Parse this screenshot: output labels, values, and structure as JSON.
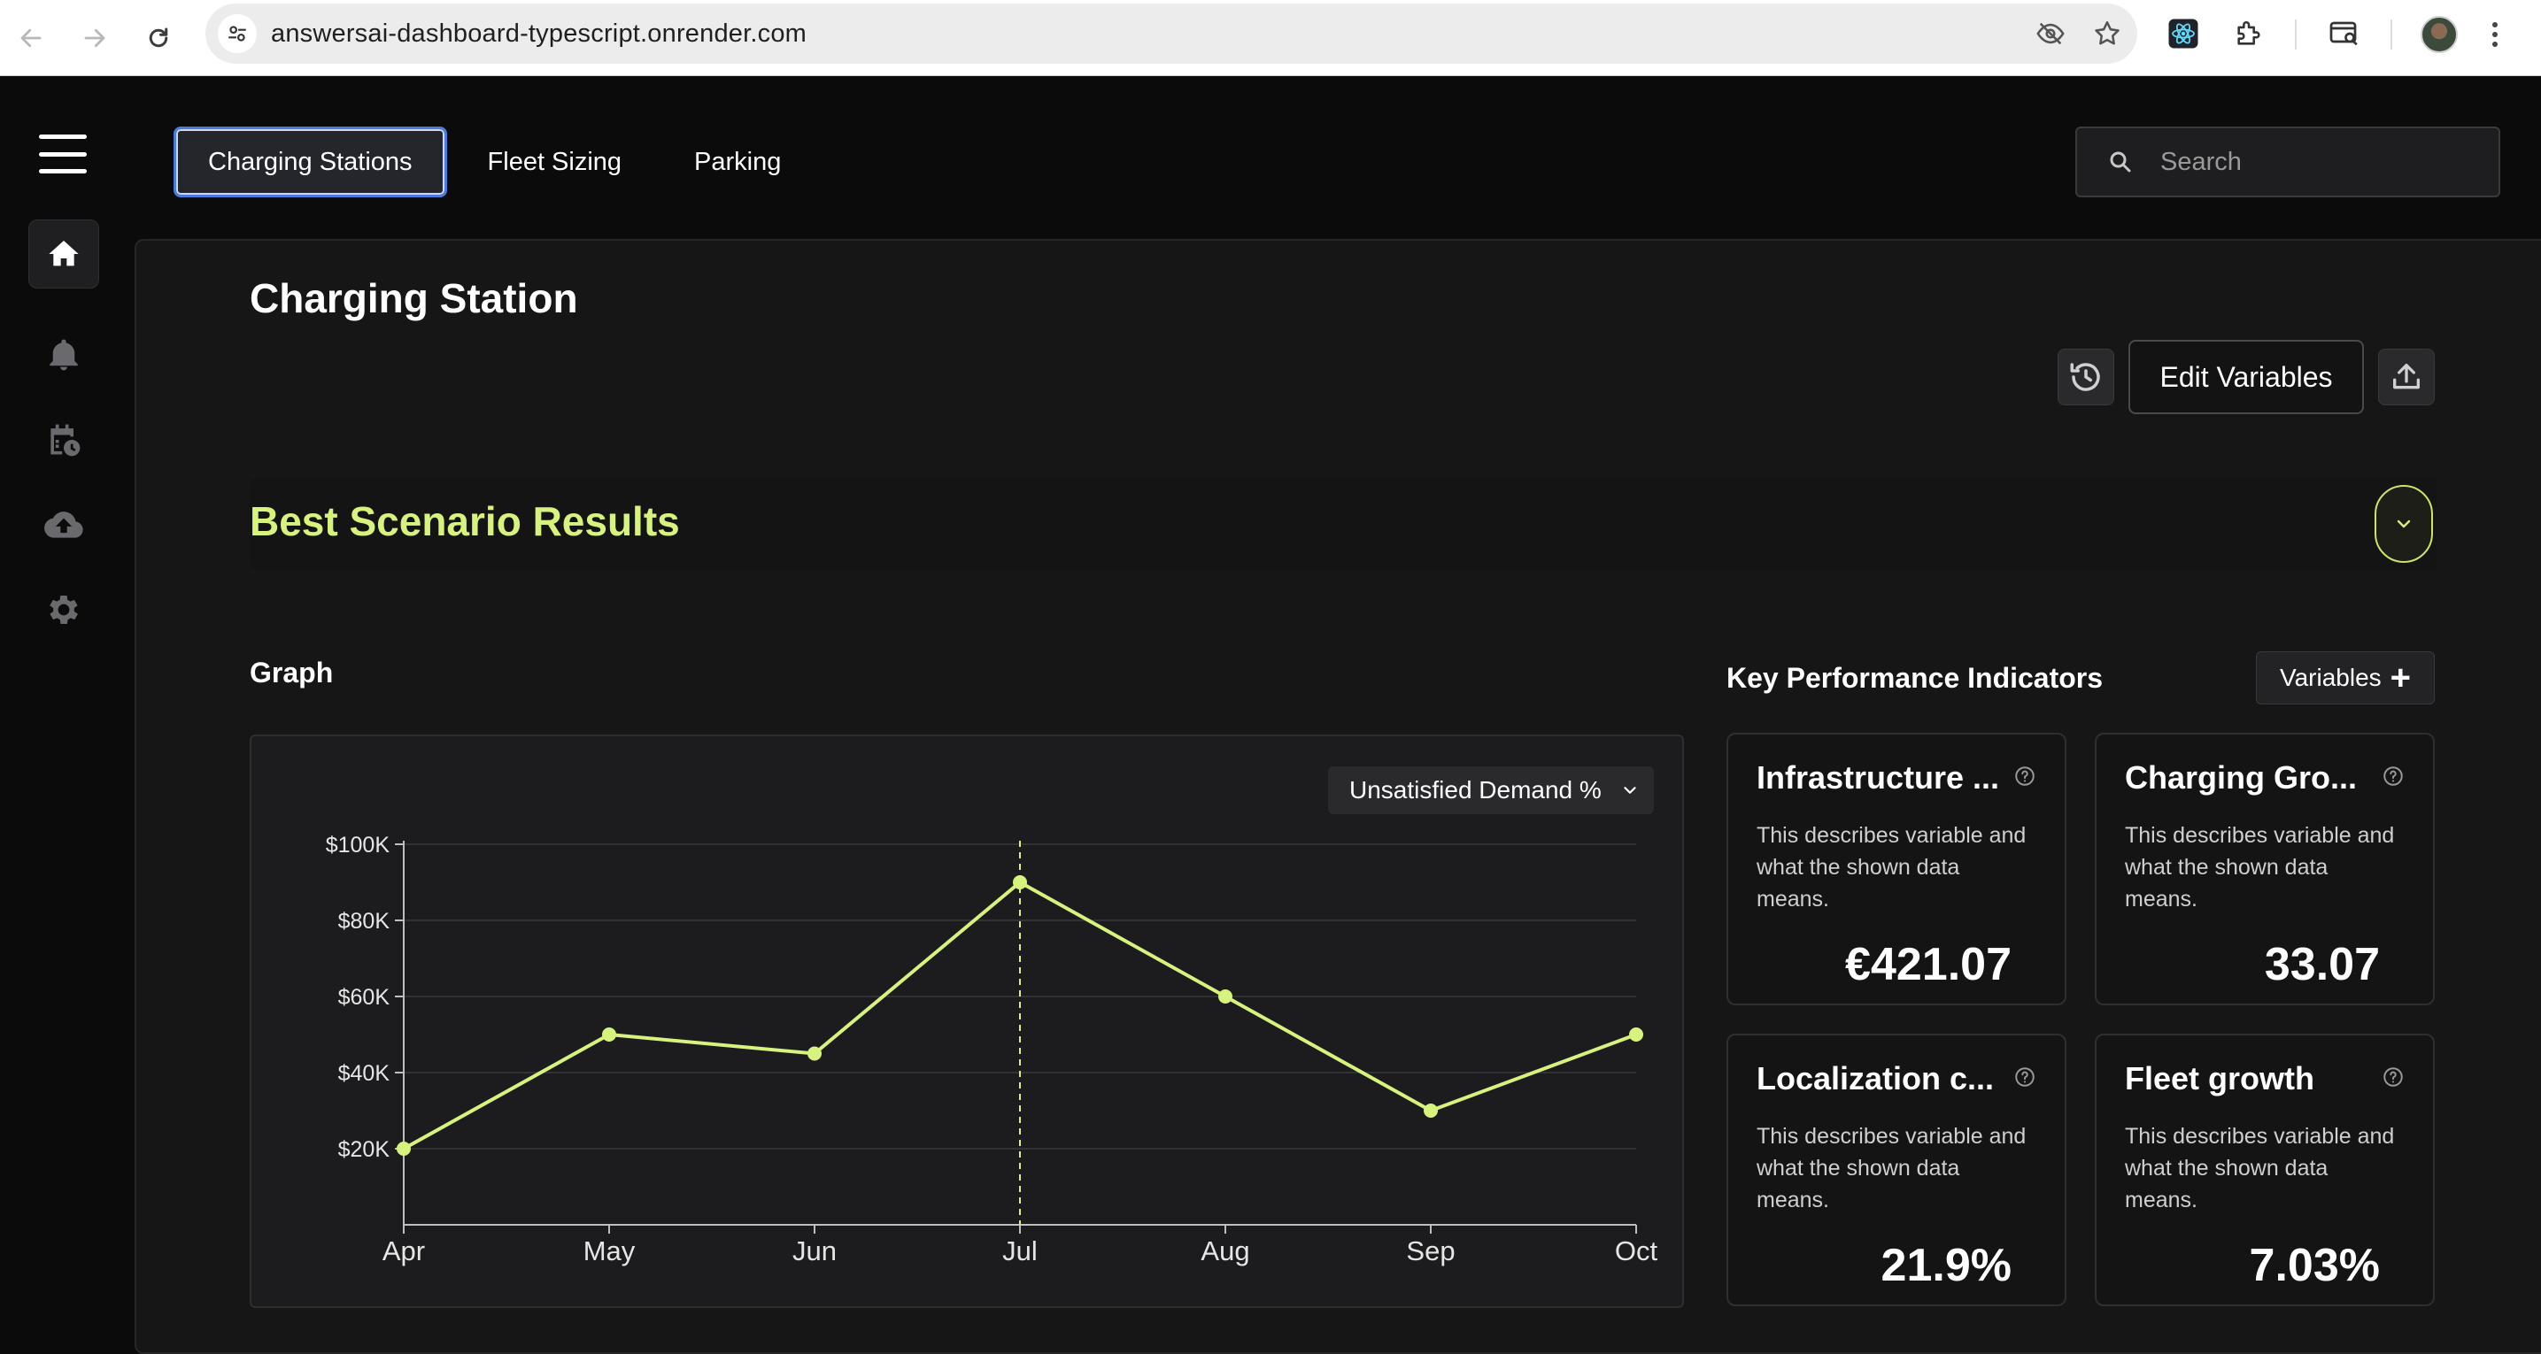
{
  "browser": {
    "url": "answersai-dashboard-typescript.onrender.com"
  },
  "nav": {
    "tabs": [
      {
        "label": "Charging Stations",
        "active": true
      },
      {
        "label": "Fleet Sizing",
        "active": false
      },
      {
        "label": "Parking",
        "active": false
      }
    ],
    "search_placeholder": "Search"
  },
  "sidebar": {
    "items": [
      {
        "icon": "home-icon",
        "active": true
      },
      {
        "icon": "bell-icon",
        "active": false
      },
      {
        "icon": "calendar-clock-icon",
        "active": false
      },
      {
        "icon": "cloud-upload-icon",
        "active": false
      },
      {
        "icon": "gear-icon",
        "active": false
      }
    ]
  },
  "page": {
    "title": "Charging Station",
    "edit_variables_label": "Edit Variables",
    "scenario_title": "Best Scenario Results"
  },
  "graph": {
    "label": "Graph",
    "metric_selected": "Unsatisfied Demand %"
  },
  "chart_data": {
    "type": "line",
    "categories": [
      "Apr",
      "May",
      "Jun",
      "Jul",
      "Aug",
      "Sep",
      "Oct"
    ],
    "values": [
      20000,
      50000,
      45000,
      90000,
      60000,
      30000,
      50000
    ],
    "yticks": [
      "$20K",
      "$40K",
      "$60K",
      "$80K",
      "$100K"
    ],
    "ytick_values": [
      20000,
      40000,
      60000,
      80000,
      100000
    ],
    "ylim": [
      0,
      100000
    ],
    "highlight_category": "Jul",
    "grid": true,
    "line_color": "#d7f27d"
  },
  "kpi": {
    "heading": "Key Performance Indicators",
    "variables_label": "Variables",
    "cards": [
      {
        "title": "Infrastructure ...",
        "desc": "This describes variable and what the shown data means.",
        "value": "€421.07"
      },
      {
        "title": "Charging Gro...",
        "desc": "This describes variable and what the shown data means.",
        "value": "33.07"
      },
      {
        "title": "Localization c...",
        "desc": "This describes variable and what the shown data means.",
        "value": "21.9%"
      },
      {
        "title": "Fleet growth",
        "desc": "This describes variable and what the shown data means.",
        "value": "7.03%"
      }
    ]
  },
  "colors": {
    "accent": "#d7f27d",
    "background": "#0b0b0c",
    "panel": "#161617"
  }
}
